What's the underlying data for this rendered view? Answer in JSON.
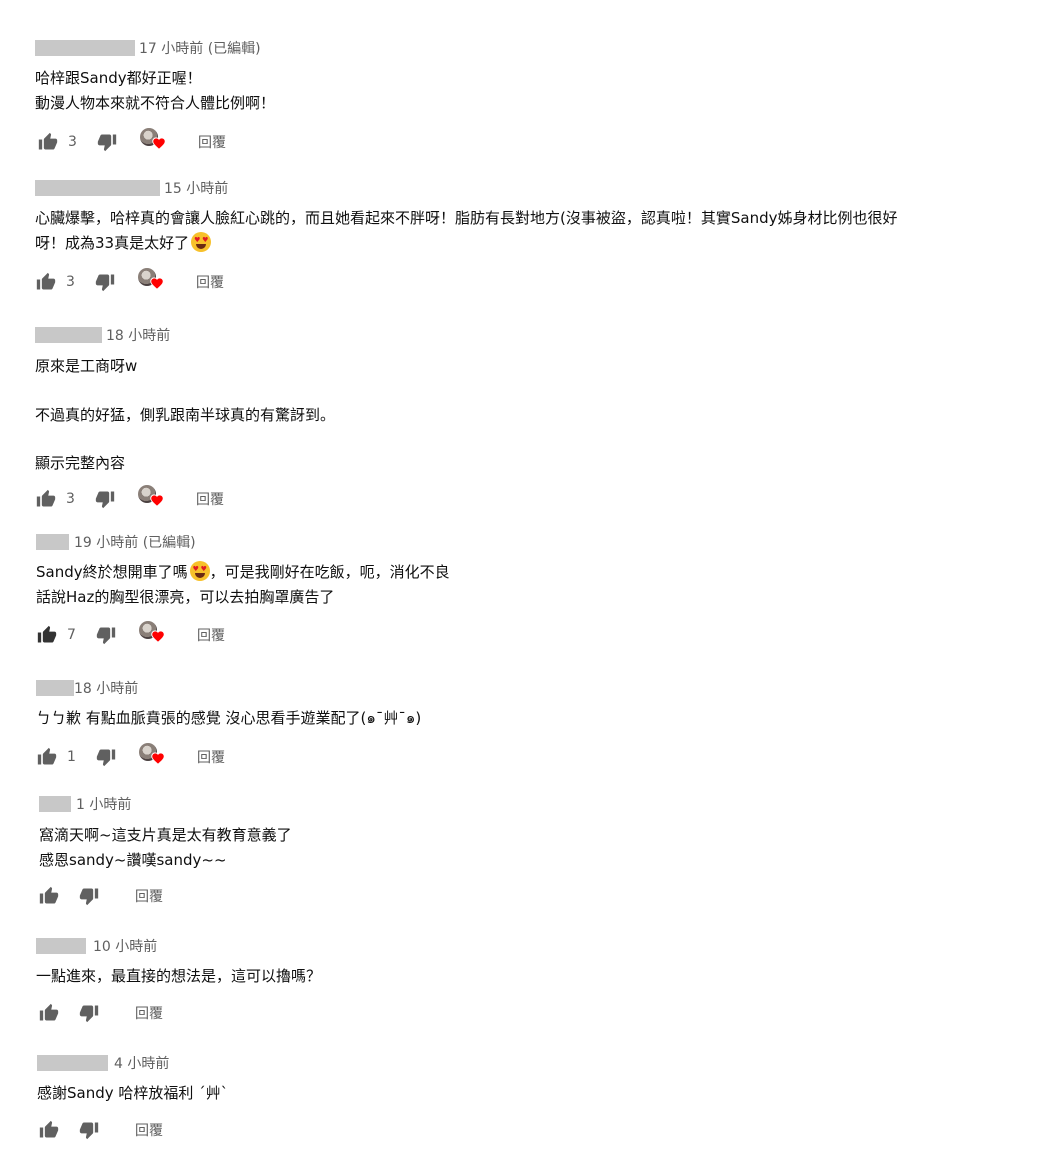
{
  "comments": [
    {
      "time": "17 小時前 (已編輯)",
      "lines": [
        "哈梓跟Sandy都好正喔！",
        "動漫人物本來就不符合人體比例啊！"
      ],
      "likes": "3",
      "reply": "回覆"
    },
    {
      "time": "15 小時前",
      "lines": [
        "心臟爆擊，哈梓真的會讓人臉紅心跳的，而且她看起來不胖呀！脂肪有長對地方(沒事被盜，認真啦！其實Sandy姊身材比例也很好",
        "呀！成為33真是太好了"
      ],
      "likes": "3",
      "reply": "回覆"
    },
    {
      "time": "18 小時前",
      "lines": [
        "原來是工商呀w",
        "",
        "不過真的好猛，側乳跟南半球真的有驚訝到。",
        "",
        "顯示完整內容"
      ],
      "likes": "3",
      "reply": "回覆"
    },
    {
      "time": "19 小時前 (已編輯)",
      "lines": [
        "Sandy終於想開車了嗎",
        "，可是我剛好在吃飯，呃，消化不良",
        "話說Haz的胸型很漂亮，可以去拍胸罩廣告了"
      ],
      "likes": "7",
      "reply": "回覆"
    },
    {
      "time": "18 小時前",
      "lines": [
        "ㄅㄅ歉 有點血脈賁張的感覺 沒心思看手遊業配了(๑¯艸¯๑)"
      ],
      "likes": "1",
      "reply": "回覆"
    },
    {
      "time": "1 小時前",
      "lines": [
        "窩滴天啊~這支片真是太有教育意義了",
        "感恩sandy~讚嘆sandy~~"
      ],
      "likes": "",
      "reply": "回覆"
    },
    {
      "time": "10 小時前",
      "lines": [
        "一點進來，最直接的想法是，這可以擼嗎？"
      ],
      "likes": "",
      "reply": "回覆"
    },
    {
      "time": "4 小時前",
      "lines": [
        "感謝Sandy 哈梓放福利 ˊ艸ˋ"
      ],
      "likes": "",
      "reply": "回覆"
    }
  ],
  "icons": {
    "like": "thumb-up-icon",
    "dislike": "thumb-down-icon",
    "creator_heart": "creator-heart-icon",
    "emoji": "heart-eyes-emoji-icon"
  },
  "colors": {
    "heart": "#ff0000",
    "meta_text": "#606060",
    "icon": "#606060",
    "redaction": "#c8c8c8"
  }
}
